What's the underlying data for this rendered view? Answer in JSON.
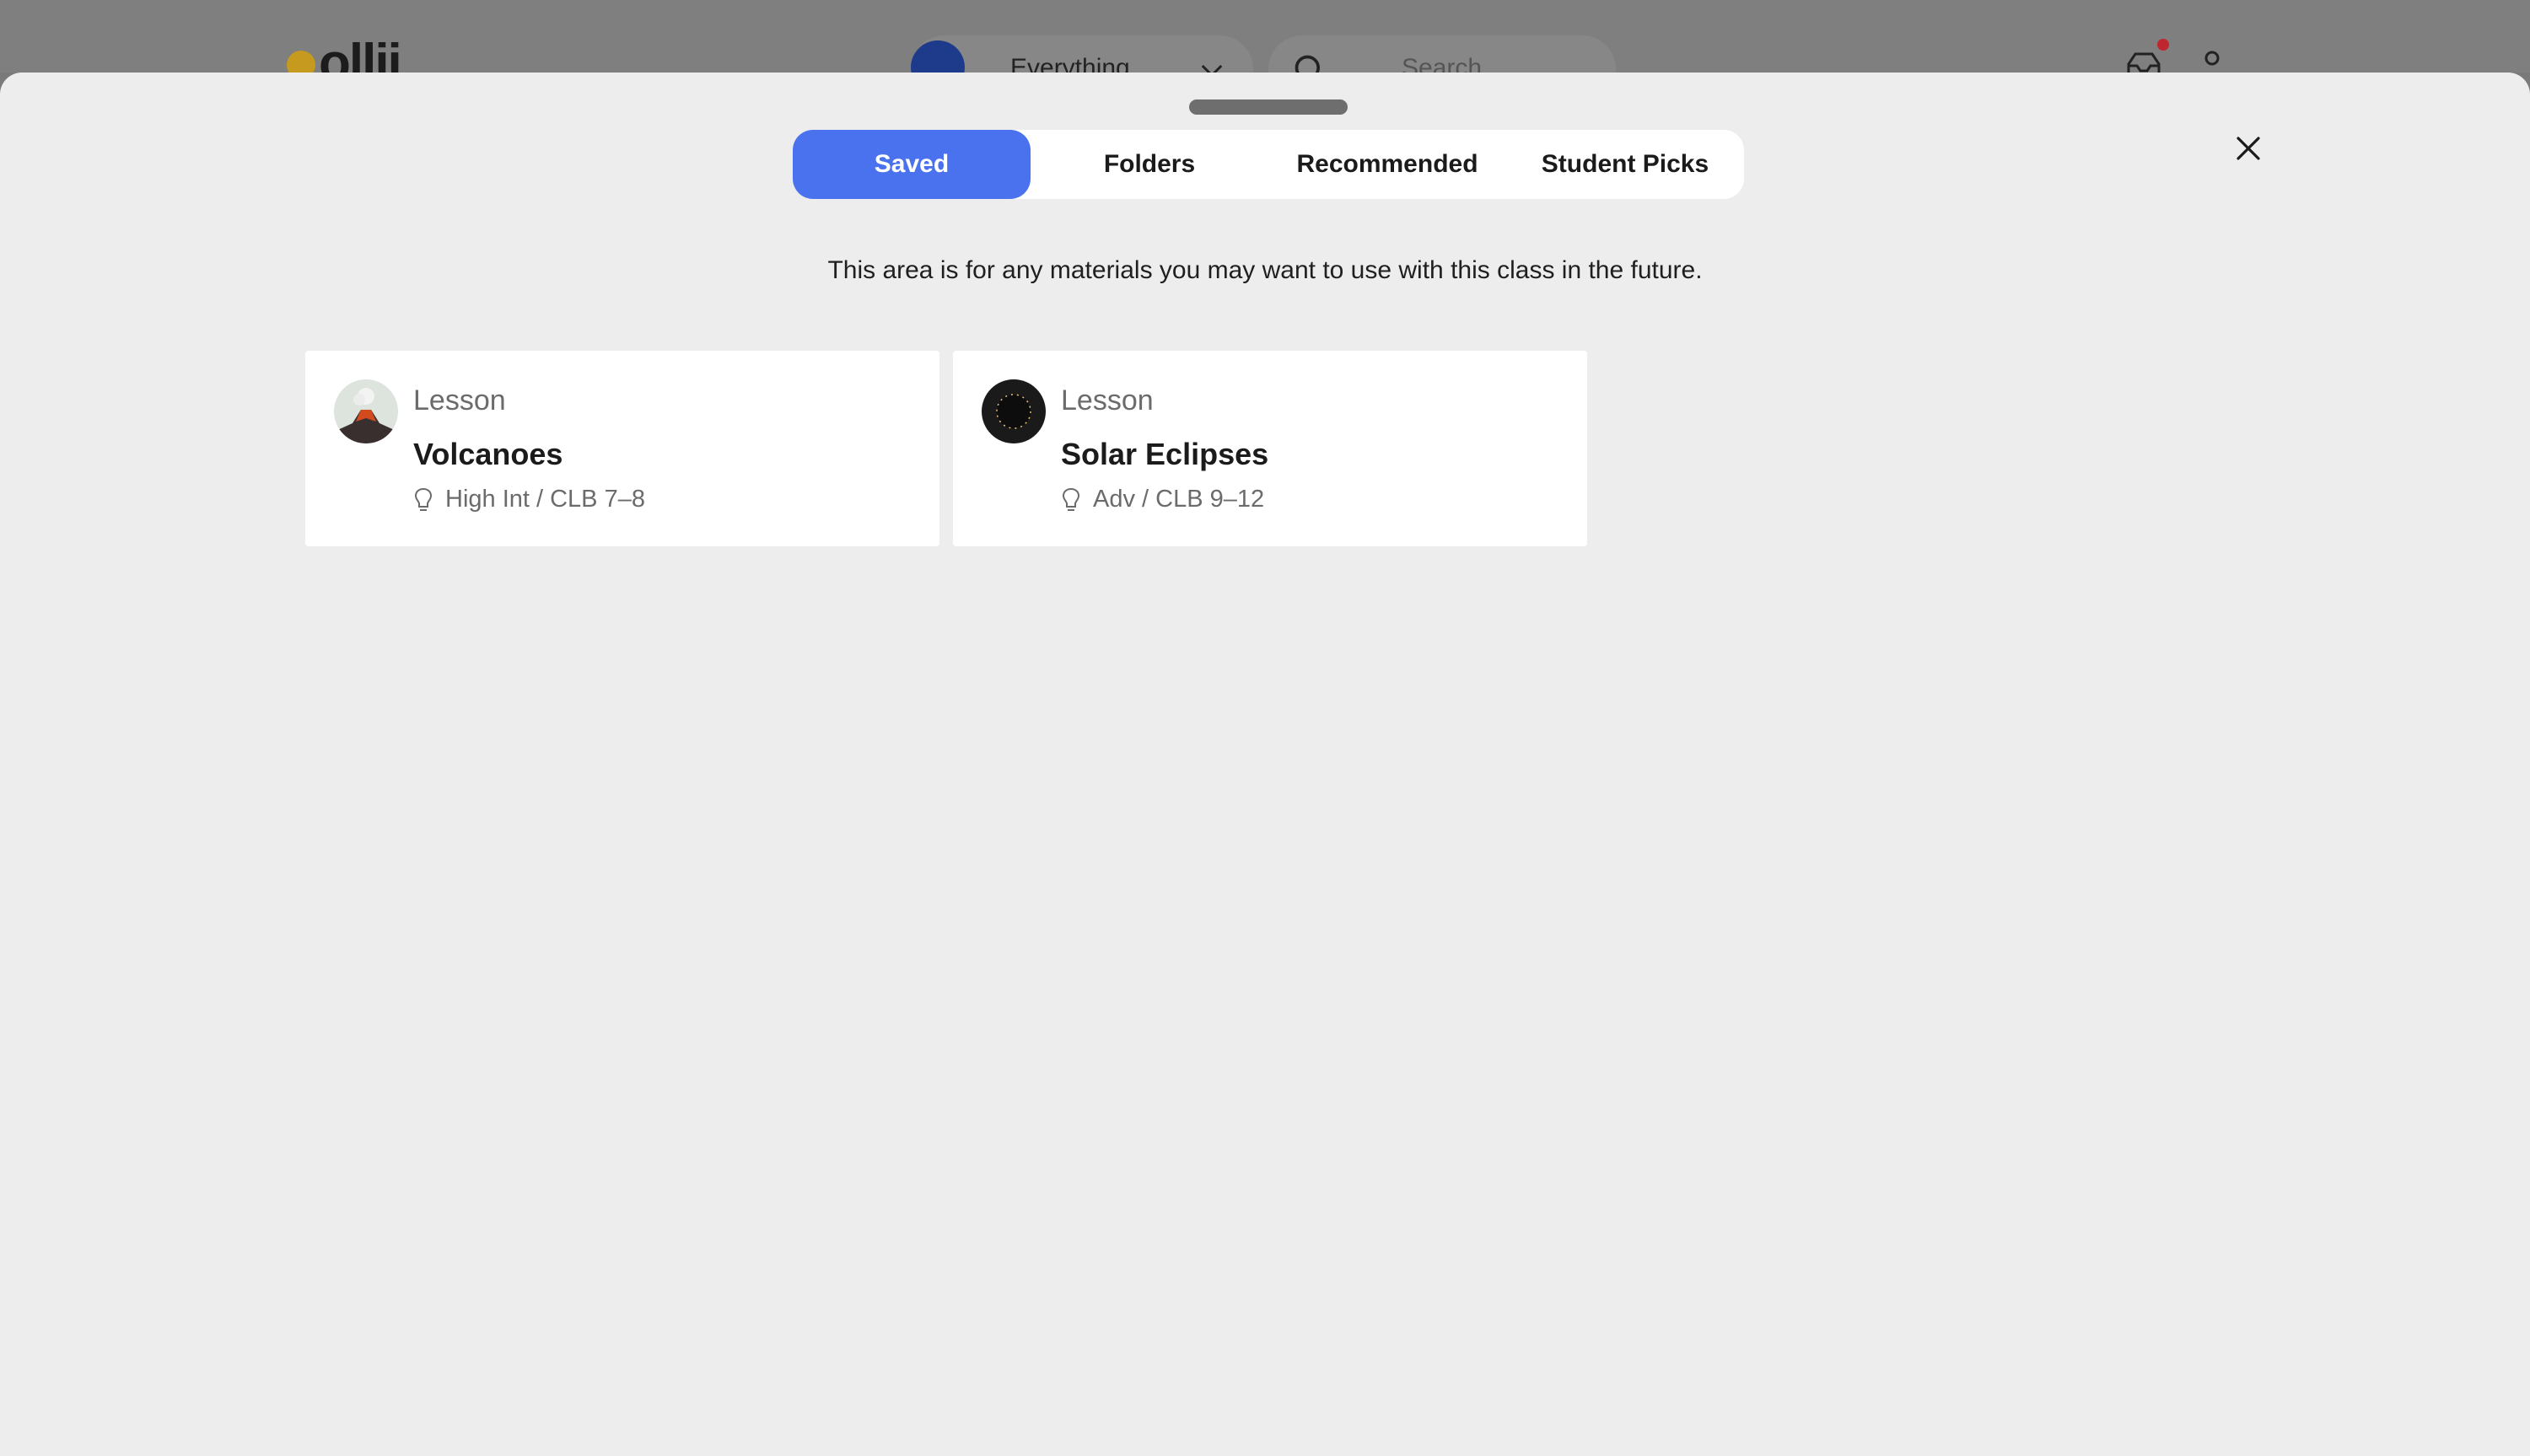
{
  "background_header": {
    "logo_text": "ollii",
    "scope_select": {
      "value": "Everything"
    },
    "search": {
      "placeholder": "Search"
    },
    "colors": {
      "notification_dot": "#c0262d",
      "scope_avatar": "#1e3a8a",
      "logo_owl": "#c59a1e"
    }
  },
  "modal": {
    "tabs": [
      {
        "label": "Saved",
        "active": true
      },
      {
        "label": "Folders",
        "active": false
      },
      {
        "label": "Recommended",
        "active": false
      },
      {
        "label": "Student Picks",
        "active": false
      }
    ],
    "description": "This area is for any materials you may want to use with this class in the future.",
    "cards": [
      {
        "kind": "Lesson",
        "title": "Volcanoes",
        "level": "High Int / CLB 7–8",
        "thumb_icon": "volcano-icon"
      },
      {
        "kind": "Lesson",
        "title": "Solar Eclipses",
        "level": "Adv / CLB 9–12",
        "thumb_icon": "solar-eclipse-icon"
      }
    ],
    "colors": {
      "active_tab": "#4a72ee",
      "sheet_bg": "#ededed"
    }
  }
}
